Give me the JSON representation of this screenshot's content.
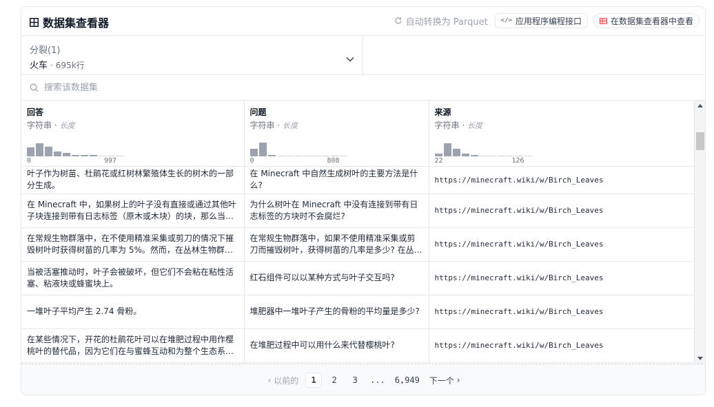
{
  "header": {
    "title": "数据集查看器",
    "auto_convert": "自动转换为 Parquet",
    "api_button": "应用程序编程接口",
    "viewer_button": "在数据集查看器中查看"
  },
  "split": {
    "label": "分裂",
    "count": "(1)",
    "selected": "火车",
    "rows": "695k行"
  },
  "search": {
    "placeholder": "搜索该数据集"
  },
  "columns": [
    {
      "name": "回答",
      "type": "字符串",
      "stat": "长度",
      "min": "0",
      "max": "997",
      "hist": [
        0.55,
        0.8,
        0.6,
        0.3,
        0.2,
        0.1,
        0.07,
        0.05,
        0,
        0,
        0
      ]
    },
    {
      "name": "问题",
      "type": "字符串",
      "stat": "长度",
      "min": "0",
      "max": "808",
      "hist": [
        0.45,
        0.85,
        0.05,
        0,
        0,
        0,
        0,
        0,
        0,
        0,
        0
      ]
    },
    {
      "name": "来源",
      "type": "字符串",
      "stat": "长度",
      "min": "22",
      "max": "126",
      "hist": [
        0.15,
        0.8,
        0.45,
        0.15,
        0.05,
        0,
        0,
        0,
        0,
        0,
        0
      ]
    }
  ],
  "rows": [
    {
      "answer": "叶子作为树苗、杜鹃花或红树林繁殖体生长的树木的一部分生成。",
      "question": "在 Minecraft 中自然生成树叶的主要方法是什么?",
      "source": "https://minecraft.wiki/w/Birch_Leaves"
    },
    {
      "answer": "在 Minecraft 中，如果树上的叶子没有直接或通过其他叶子块连接到带有日志标签（原木或木块）的块，那么当…",
      "question": "为什么树叶在 Minecraft 中没有连接到带有日志标签的方块时不会腐烂?",
      "source": "https://minecraft.wiki/w/Birch_Leaves"
    },
    {
      "answer": "在常规生物群落中，在不使用精准采集或剪刀的情况下摧毁树叶时获得树苗的几率为 5%。然而，在丛林生物群落…",
      "question": "在常规生物群落中，如果不使用精准采集或剪刀而摧毁树叶，获得树苗的几率是多少? 在丛…",
      "source": "https://minecraft.wiki/w/Birch_Leaves"
    },
    {
      "answer": "当被活塞推动时，叶子会被破坏，但它们不会粘在粘性活塞、粘液块或蜂蜜块上。",
      "question": "红石组件可以以某种方式与叶子交互吗?",
      "source": "https://minecraft.wiki/w/Birch_Leaves"
    },
    {
      "answer": "一堆叶子平均产生 2.74 骨粉。",
      "question": "堆肥器中一堆叶子产生的骨粉的平均量是多少?",
      "source": "https://minecraft.wiki/w/Birch_Leaves"
    },
    {
      "answer": "在某些情况下，开花的杜鹃花叶可以在堆肥过程中用作樱桃叶的替代品，因为它们在与蜜蜂互动和为整个生态系统…",
      "question": "在堆肥过程中可以用什么来代替樱桃叶?",
      "source": "https://minecraft.wiki/w/Birch_Leaves"
    }
  ],
  "pagination": {
    "prev": "以前的",
    "pages": [
      "1",
      "2",
      "3"
    ],
    "ellipsis": "...",
    "last": "6,949",
    "next": "下一个"
  },
  "colors": {
    "accent_red": "#ef4444",
    "hist_bar": "#9ca3af",
    "border": "#e5e7eb"
  }
}
